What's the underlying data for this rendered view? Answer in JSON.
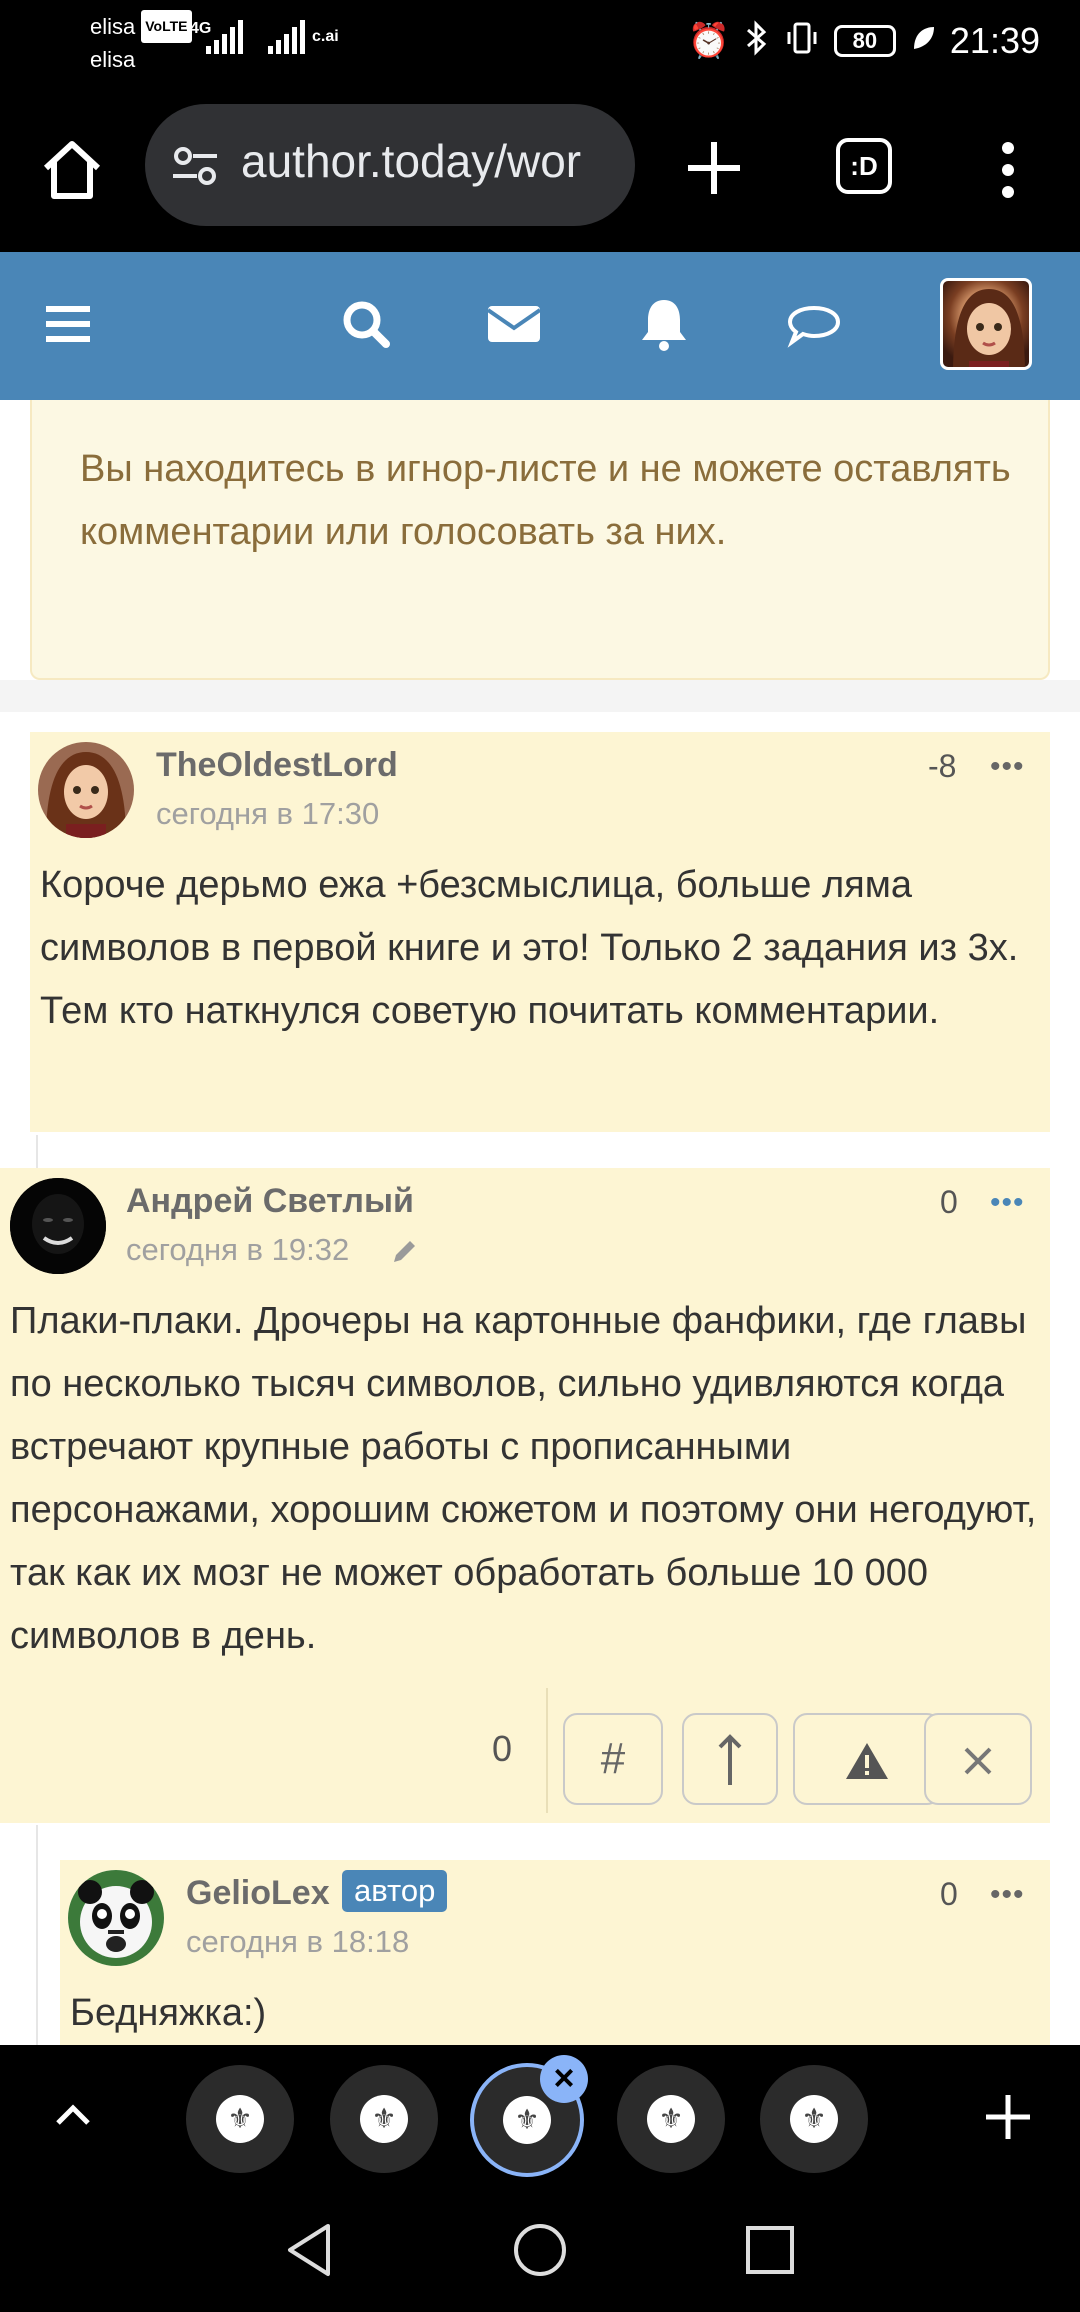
{
  "status": {
    "carrier1": "elisa",
    "carrier2": "elisa",
    "volte": "VoLTE",
    "net1": "4G",
    "net2": "c.ai",
    "battery": "80",
    "time": "21:39"
  },
  "browser": {
    "url": "author.today/wor",
    "tabs_label": ":D"
  },
  "notice": {
    "text": "Вы находитесь в игнор-листе и не можете оставлять комментарии или голосовать за них."
  },
  "comments": [
    {
      "author": "TheOldestLord",
      "date": "сегодня в 17:30",
      "score": "-8",
      "more": "•••",
      "text": "Короче дерьмо ежа +безсмыслица, больше ляма символов в первой книге и это! Только 2 задания из 3х. Тем кто наткнулся советую почитать комментарии."
    },
    {
      "author": "Андрей Светлый",
      "date": "сегодня в 19:32",
      "score": "0",
      "more": "•••",
      "text": "Плаки-плаки. Дрочеры на картонные фанфики, где главы по несколько тысяч символов, сильно удивляются когда встречают крупные работы с прописанными персонажами, хорошим сюжетом и поэтому они негодуют, так как их мозг не может обработать больше 10 000 символов в день.",
      "vote_count": "0",
      "actions": {
        "hash": "#",
        "up": "↑",
        "report": "!",
        "close": "×"
      }
    },
    {
      "author": "GelioLex",
      "badge": "автор",
      "date": "сегодня в 18:18",
      "score": "0",
      "more": "•••",
      "text": "Бедняжка:)"
    }
  ],
  "tabstrip": {
    "close_label": "×"
  },
  "colors": {
    "nav_blue": "#4a86b7",
    "comment_bg": "#fdf5d3",
    "notice_text": "#8a6d3b",
    "dots_blue": "#4a86b7"
  }
}
